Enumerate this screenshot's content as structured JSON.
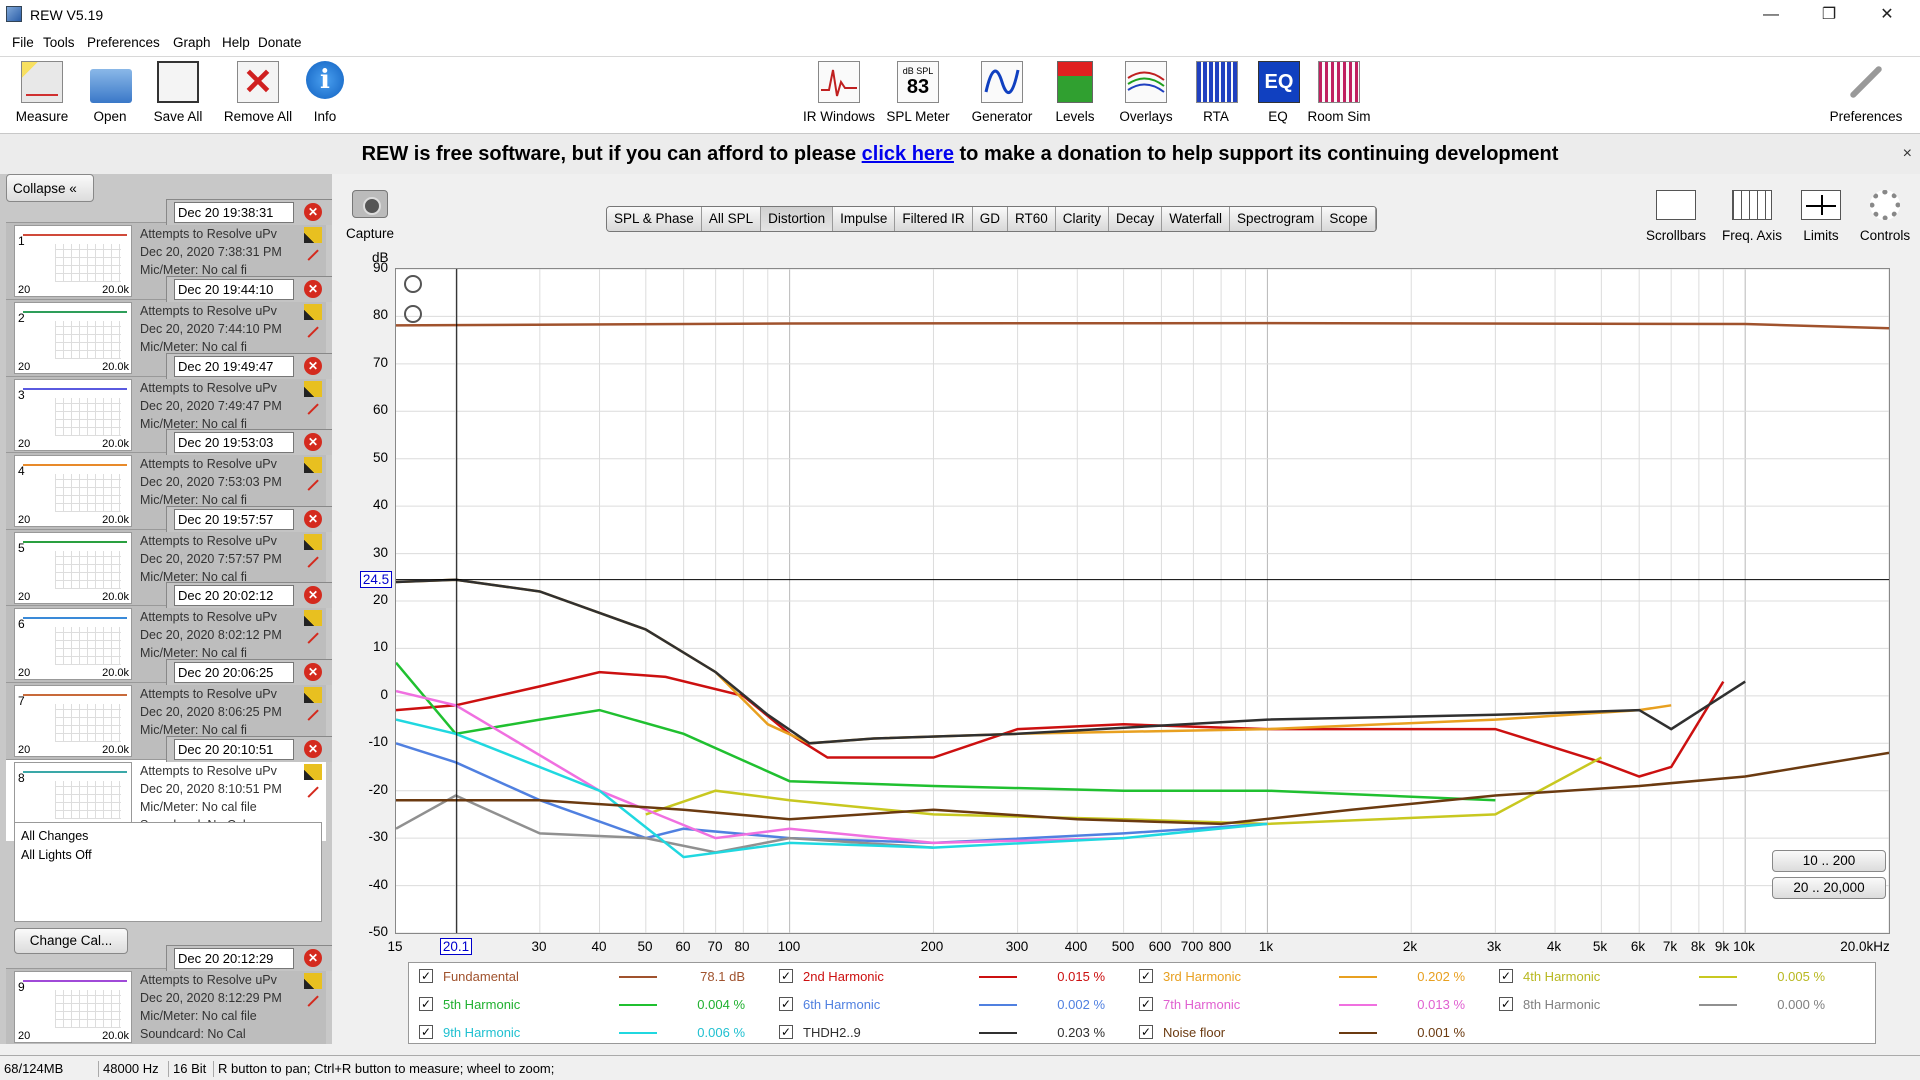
{
  "window": {
    "title": "REW V5.19",
    "minimize": "—",
    "restore": "❐",
    "close": "✕"
  },
  "menu": [
    "File",
    "Tools",
    "Preferences",
    "Graph",
    "Help",
    "Donate"
  ],
  "toolbar": {
    "left": [
      {
        "label": "Measure",
        "icon": "measure-icon"
      },
      {
        "label": "Open",
        "icon": "folder-icon"
      },
      {
        "label": "Save All",
        "icon": "save-icon"
      },
      {
        "label": "Remove All",
        "icon": "remove-icon"
      },
      {
        "label": "Info",
        "icon": "info-icon"
      }
    ],
    "center": [
      {
        "label": "IR Windows",
        "icon": "ir-windows-icon"
      },
      {
        "label": "SPL Meter",
        "icon": "spl-meter-icon",
        "badge_top": "dB SPL",
        "badge_value": "83"
      },
      {
        "label": "Generator",
        "icon": "generator-icon"
      },
      {
        "label": "Levels",
        "icon": "levels-icon"
      },
      {
        "label": "Overlays",
        "icon": "overlays-icon"
      },
      {
        "label": "RTA",
        "icon": "rta-icon"
      },
      {
        "label": "EQ",
        "icon": "eq-icon",
        "badge_value": "EQ"
      },
      {
        "label": "Room Sim",
        "icon": "room-sim-icon"
      }
    ],
    "right": [
      {
        "label": "Preferences",
        "icon": "wrench-icon"
      }
    ]
  },
  "donate": {
    "before": "REW is free software, but if you can afford to please ",
    "link": "click here",
    "after": " to make a donation to help support its continuing development",
    "close": "×"
  },
  "left_panel": {
    "collapse_label": "Collapse «",
    "measurements": [
      {
        "num": "1",
        "date": "Dec 20 19:38:31",
        "name": "Attempts to Resolve uPv",
        "stamp": "Dec 20, 2020 7:38:31 PM",
        "color": "#d04a3a",
        "lo": "20",
        "hi": "20.0k"
      },
      {
        "num": "2",
        "date": "Dec 20 19:44:10",
        "name": "Attempts to Resolve uPv",
        "stamp": "Dec 20, 2020 7:44:10 PM",
        "color": "#2e9e5a",
        "lo": "20",
        "hi": "20.0k"
      },
      {
        "num": "3",
        "date": "Dec 20 19:49:47",
        "name": "Attempts to Resolve uPv",
        "stamp": "Dec 20, 2020 7:49:47 PM",
        "color": "#5a5ae0",
        "lo": "20",
        "hi": "20.0k"
      },
      {
        "num": "4",
        "date": "Dec 20 19:53:03",
        "name": "Attempts to Resolve uPv",
        "stamp": "Dec 20, 2020 7:53:03 PM",
        "color": "#e88a2a",
        "lo": "20",
        "hi": "20.0k"
      },
      {
        "num": "5",
        "date": "Dec 20 19:57:57",
        "name": "Attempts to Resolve uPv",
        "stamp": "Dec 20, 2020 7:57:57 PM",
        "color": "#2aa040",
        "lo": "20",
        "hi": "20.0k"
      },
      {
        "num": "6",
        "date": "Dec 20 20:02:12",
        "name": "Attempts to Resolve uPv",
        "stamp": "Dec 20, 2020 8:02:12 PM",
        "color": "#3a8ad8",
        "lo": "20",
        "hi": "20.0k"
      },
      {
        "num": "7",
        "date": "Dec 20 20:06:25",
        "name": "Attempts to Resolve uPv",
        "stamp": "Dec 20, 2020 8:06:25 PM",
        "color": "#c86a3a",
        "lo": "20",
        "hi": "20.0k"
      },
      {
        "num": "8",
        "date": "Dec 20 20:10:51",
        "name": "Attempts to Resolve uPv",
        "stamp": "Dec 20, 2020 8:10:51 PM",
        "color": "#3aa8a8",
        "lo": "20",
        "hi": "20.0k",
        "mic": "Mic/Meter: No cal file",
        "soundcard": "Soundcard: No Cal"
      },
      {
        "num": "9",
        "date": "Dec 20 20:12:29",
        "name": "Attempts to Resolve uPv",
        "stamp": "Dec 20, 2020 8:12:29 PM",
        "color": "#a04ad8",
        "lo": "20",
        "hi": "20.0k",
        "mic": "Mic/Meter: No cal file",
        "soundcard": "Soundcard: No Cal"
      }
    ],
    "partial_mic": "Mic/Meter: No cal fi",
    "changes": [
      "All Changes",
      "All Lights Off"
    ],
    "change_cal": "Change Cal..."
  },
  "graph": {
    "capture": "Capture",
    "tabs": [
      "SPL & Phase",
      "All SPL",
      "Distortion",
      "Impulse",
      "Filtered IR",
      "GD",
      "RT60",
      "Clarity",
      "Decay",
      "Waterfall",
      "Spectrogram",
      "Scope"
    ],
    "active_tab": "Distortion",
    "right_tools": [
      "Scrollbars",
      "Freq. Axis",
      "Limits",
      "Controls"
    ],
    "y_unit": "dB",
    "cursor_y": "24.5",
    "cursor_x": "20.1",
    "range_buttons": [
      "10 .. 200",
      "20 .. 20,000"
    ]
  },
  "chart_data": {
    "type": "line",
    "xscale": "log",
    "xlim": [
      15,
      20000
    ],
    "ylim": [
      -50,
      90
    ],
    "yticks": [
      "90",
      "80",
      "70",
      "60",
      "50",
      "40",
      "30",
      "20",
      "10",
      "0",
      "-10",
      "-20",
      "-30",
      "-40",
      "-50"
    ],
    "xticks": [
      "15",
      "30",
      "40",
      "50",
      "60",
      "70",
      "80",
      "100",
      "200",
      "300",
      "400",
      "500",
      "600",
      "700",
      "800",
      "1k",
      "2k",
      "3k",
      "4k",
      "5k",
      "6k",
      "7k",
      "8k",
      "9k",
      "10k",
      "20.0kHz"
    ],
    "grid": true,
    "series": [
      {
        "name": "Fundamental",
        "color": "#a0522d",
        "x": [
          15,
          100,
          1000,
          10000,
          20000
        ],
        "y": [
          78.1,
          78.5,
          78.6,
          78.4,
          77.5
        ]
      },
      {
        "name": "2nd Harmonic",
        "color": "#cc1010",
        "x": [
          15,
          20,
          30,
          40,
          55,
          80,
          100,
          120,
          200,
          300,
          500,
          1000,
          3000,
          5000,
          6000,
          7000,
          9000
        ],
        "y": [
          -3,
          -2,
          2,
          5,
          4,
          0,
          -8,
          -13,
          -13,
          -7,
          -6,
          -7,
          -7,
          -14,
          -17,
          -15,
          3
        ]
      },
      {
        "name": "3rd Harmonic",
        "color": "#e8a020",
        "x": [
          15,
          20,
          30,
          50,
          70,
          90,
          110,
          150,
          300,
          1000,
          3000,
          6000,
          7000
        ],
        "y": [
          24,
          24.5,
          22,
          14,
          5,
          -6,
          -10,
          -9,
          -8,
          -7,
          -5,
          -3,
          -2
        ]
      },
      {
        "name": "4th Harmonic",
        "color": "#c8c820",
        "x": [
          50,
          70,
          100,
          200,
          500,
          1000,
          3000,
          5000
        ],
        "y": [
          -25,
          -20,
          -22,
          -25,
          -26,
          -27,
          -25,
          -13
        ]
      },
      {
        "name": "5th Harmonic",
        "color": "#20c030",
        "x": [
          15,
          20,
          30,
          40,
          60,
          100,
          200,
          500,
          1000,
          3000
        ],
        "y": [
          7,
          -8,
          -5,
          -3,
          -8,
          -18,
          -19,
          -20,
          -20,
          -22
        ]
      },
      {
        "name": "6th Harmonic",
        "color": "#5080e0",
        "x": [
          15,
          20,
          30,
          50,
          60,
          100,
          200,
          500,
          1000
        ],
        "y": [
          -10,
          -14,
          -22,
          -30,
          -28,
          -30,
          -31,
          -29,
          -27
        ]
      },
      {
        "name": "7th Harmonic",
        "color": "#f070e0",
        "x": [
          15,
          20,
          40,
          70,
          100,
          200,
          500
        ],
        "y": [
          1,
          -2,
          -20,
          -30,
          -28,
          -31,
          -30
        ]
      },
      {
        "name": "8th Harmonic",
        "color": "#909090",
        "x": [
          15,
          20,
          30,
          50,
          70,
          100,
          200
        ],
        "y": [
          -28,
          -21,
          -29,
          -30,
          -33,
          -30,
          -32
        ]
      },
      {
        "name": "9th Harmonic",
        "color": "#20d8e0",
        "x": [
          15,
          20,
          40,
          60,
          100,
          200,
          500,
          1000
        ],
        "y": [
          -5,
          -8,
          -20,
          -34,
          -31,
          -32,
          -30,
          -27
        ]
      },
      {
        "name": "THD H2..9",
        "color": "#303030",
        "x": [
          15,
          20,
          30,
          50,
          70,
          90,
          110,
          150,
          300,
          1000,
          3000,
          6000,
          7000,
          10000
        ],
        "y": [
          24,
          24.5,
          22,
          14,
          5,
          -4,
          -10,
          -9,
          -8,
          -5,
          -4,
          -3,
          -7,
          3
        ]
      },
      {
        "name": "Noise floor",
        "color": "#6b3a10",
        "x": [
          15,
          30,
          60,
          100,
          200,
          400,
          800,
          1500,
          3000,
          6000,
          10000,
          20000
        ],
        "y": [
          -22,
          -22,
          -24,
          -26,
          -24,
          -26,
          -27,
          -24,
          -21,
          -19,
          -17,
          -12
        ]
      }
    ],
    "legend": [
      {
        "name": "Fundamental",
        "value": "78.1 dB",
        "color": "#a0522d",
        "text_color": "#a0522d"
      },
      {
        "name": "2nd Harmonic",
        "value": "0.015 %",
        "color": "#cc1010",
        "text_color": "#cc1010"
      },
      {
        "name": "3rd Harmonic",
        "value": "0.202 %",
        "color": "#e8a020",
        "text_color": "#e8a020"
      },
      {
        "name": "4th Harmonic",
        "value": "0.005 %",
        "color": "#c8c820",
        "text_color": "#b8b820"
      },
      {
        "name": "5th Harmonic",
        "value": "0.004 %",
        "color": "#20c030",
        "text_color": "#20b030"
      },
      {
        "name": "6th Harmonic",
        "value": "0.002 %",
        "color": "#5080e0",
        "text_color": "#5080e0"
      },
      {
        "name": "7th Harmonic",
        "value": "0.013 %",
        "color": "#f070e0",
        "text_color": "#e060d0"
      },
      {
        "name": "8th Harmonic",
        "value": "0.000 %",
        "color": "#909090",
        "text_color": "#808080"
      },
      {
        "name": "9th Harmonic",
        "value": "0.006 %",
        "color": "#20d8e0",
        "text_color": "#20c0d0"
      },
      {
        "name": "THDH2..9",
        "value": "0.203 %",
        "color": "#303030",
        "text_color": "#303030"
      },
      {
        "name": "Noise floor",
        "value": "0.001 %",
        "color": "#6b3a10",
        "text_color": "#6b3a10"
      }
    ]
  },
  "status": {
    "memory": "68/124MB",
    "rate": "48000 Hz",
    "bits": "16 Bit",
    "hint": "R button to pan; Ctrl+R button to measure; wheel to zoom;"
  }
}
